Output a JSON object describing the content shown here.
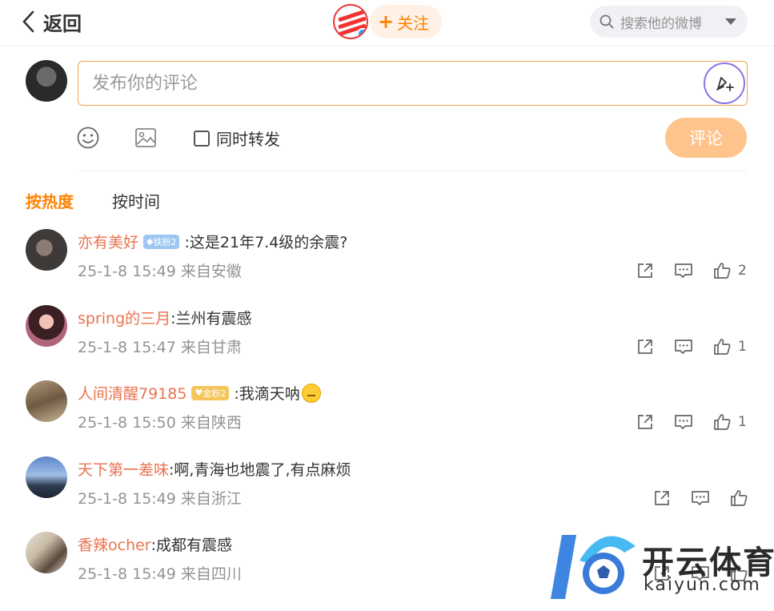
{
  "header": {
    "back_label": "返回",
    "follow_label": "关注",
    "search_placeholder": "搜索他的微博"
  },
  "composer": {
    "placeholder": "发布你的评论",
    "repost_label": "同时转发",
    "repost_checked": false,
    "submit_label": "评论"
  },
  "sort_tabs": [
    {
      "label": "按热度",
      "active": true
    },
    {
      "label": "按时间",
      "active": false
    }
  ],
  "comments": [
    {
      "user": "亦有美好",
      "badge": "铁粉2",
      "text": ":这是21年7.4级的余震?",
      "time": "25-1-8 15:49",
      "location": "来自安徽",
      "likes": "2"
    },
    {
      "user": "spring的三月",
      "badge": "",
      "text": ":兰州有震感",
      "time": "25-1-8 15:47",
      "location": "来自甘肃",
      "likes": "1"
    },
    {
      "user": "人间清醒79185",
      "badge": "金粉2",
      "text": ":我滴天呐",
      "time": "25-1-8 15:50",
      "location": "来自陕西",
      "likes": "1"
    },
    {
      "user": "天下第一差味",
      "badge": "",
      "text": ":啊,青海也地震了,有点麻烦",
      "time": "25-1-8 15:49",
      "location": "来自浙江",
      "likes": ""
    },
    {
      "user": "香辣ocher",
      "badge": "",
      "text": ":成都有震感",
      "time": "25-1-8 15:49",
      "location": "来自四川",
      "likes": ""
    }
  ],
  "watermark": {
    "brand": "开云体育",
    "domain": "kaiyun.com"
  },
  "colors": {
    "accent": "#ff8200",
    "username": "#eb7350",
    "meta": "#939393"
  }
}
